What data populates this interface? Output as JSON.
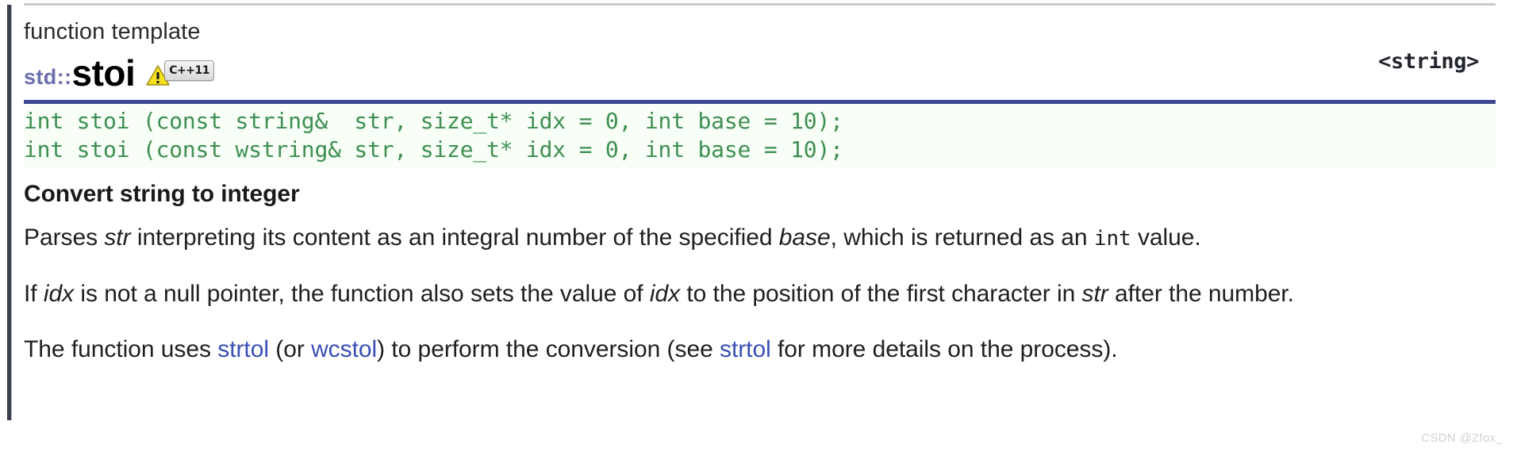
{
  "header": {
    "kind": "function template",
    "namespace_prefix": "std::",
    "function_name": "stoi",
    "standard_badge": "C++11",
    "warning_icon_name": "warning-triangle-icon",
    "include_header": "<string>"
  },
  "prototypes": [
    "int stoi (const string&  str, size_t* idx = 0, int base = 10);",
    "int stoi (const wstring& str, size_t* idx = 0, int base = 10);"
  ],
  "description": {
    "title": "Convert string to integer",
    "paragraph1": {
      "part1": "Parses ",
      "em1": "str",
      "part2": " interpreting its content as an integral number of the specified ",
      "em2": "base",
      "part3": ", which is returned as an ",
      "code1": "int",
      "part4": " value."
    },
    "paragraph2": {
      "part1": "If ",
      "em1": "idx",
      "part2": " is not a null pointer, the function also sets the value of ",
      "em2": "idx",
      "part3": " to the position of the first character in ",
      "em3": "str",
      "part4": " after the number."
    },
    "paragraph3": {
      "part1": "The function uses ",
      "link1": "strtol",
      "part2": " (or ",
      "link2": "wcstol",
      "part3": ") to perform the conversion (see ",
      "link3": "strtol",
      "part4": " for more details on the process)."
    }
  },
  "watermark": "CSDN @Zfox_",
  "colors": {
    "namespace": "#6b6fae",
    "code_green": "#3f8f52",
    "link_blue": "#3a4fb5",
    "proto_border": "#3b4790",
    "proto_background": "#f7fff7"
  }
}
